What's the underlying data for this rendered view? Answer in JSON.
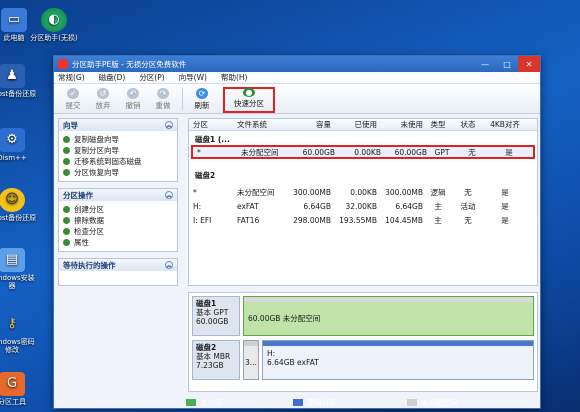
{
  "desktop": {
    "icons": [
      {
        "label": "此电脑"
      },
      {
        "label": "分区助手(无损)"
      },
      {
        "label": "Ghost备份还原"
      },
      {
        "label": "Dism++"
      },
      {
        "label": "Ghost备份还原"
      },
      {
        "label": "Windows安装器"
      },
      {
        "label": "Windows密码修改"
      },
      {
        "label": "分区工具"
      }
    ]
  },
  "window": {
    "title": "分区助手PE版 - 无损分区免费软件",
    "controls": {
      "minimize": "—",
      "maximize": "□",
      "close": "✕"
    }
  },
  "menu": [
    "常规(G)",
    "磁盘(D)",
    "分区(P)",
    "向导(W)",
    "帮助(H)"
  ],
  "toolbar": {
    "items": [
      {
        "label": "提交",
        "icon": "✓"
      },
      {
        "label": "放弃",
        "icon": "↺"
      },
      {
        "label": "撤销",
        "icon": "↶"
      },
      {
        "label": "重做",
        "icon": "↷"
      },
      {
        "label": "刷新",
        "icon": "⟳"
      },
      {
        "label": "快速分区",
        "icon": "●"
      }
    ]
  },
  "left": {
    "wizard": {
      "title": "向导",
      "items": [
        "复制磁盘向导",
        "复制分区向导",
        "迁移系统到固态磁盘",
        "分区恢复向导"
      ]
    },
    "partition_ops": {
      "title": "分区操作",
      "items": [
        "创建分区",
        "擦除数据",
        "检查分区",
        "属性"
      ]
    },
    "pending": {
      "title": "等待执行的操作"
    }
  },
  "table": {
    "headers": [
      "分区",
      "文件系统",
      "容量",
      "已使用",
      "未使用",
      "类型",
      "状态",
      "4KB对齐"
    ],
    "disk1": {
      "label": "磁盘1 (...",
      "rows": [
        {
          "part": "*",
          "fs": "未分配空间",
          "cap": "60.00GB",
          "used": "0.00KB",
          "free": "60.00GB",
          "type": "GPT",
          "status": "无",
          "align": "是"
        }
      ]
    },
    "disk2": {
      "label": "磁盘2",
      "rows": [
        {
          "part": "*",
          "fs": "未分配空间",
          "cap": "300.00MB",
          "used": "0.00KB",
          "free": "300.00MB",
          "type": "逻辑",
          "status": "无",
          "align": "是"
        },
        {
          "part": "H:",
          "fs": "exFAT",
          "cap": "6.64GB",
          "used": "32.00KB",
          "free": "6.64GB",
          "type": "主",
          "status": "活动",
          "align": "是"
        },
        {
          "part": "I: EFI",
          "fs": "FAT16",
          "cap": "298.00MB",
          "used": "193.55MB",
          "free": "104.45MB",
          "type": "主",
          "status": "无",
          "align": "是"
        }
      ]
    }
  },
  "diskmap": {
    "disk1": {
      "name": "磁盘1",
      "kind": "基本 GPT",
      "size": "60.00GB",
      "part_line1": "60.00GB 未分配空间"
    },
    "disk2": {
      "name": "磁盘2",
      "kind": "基本 MBR",
      "size": "7.23GB",
      "small": "3...",
      "part_drive": "H:",
      "part_line1": "6.64GB exFAT"
    }
  },
  "statusbar": {
    "primary": "主分区",
    "logical": "逻辑分区",
    "unalloc": "未分配空间"
  },
  "colors": {
    "selection": "#e02222",
    "primary": "#4caf50",
    "logical": "#3f6fd0",
    "unalloc": "#cfcfcf"
  }
}
